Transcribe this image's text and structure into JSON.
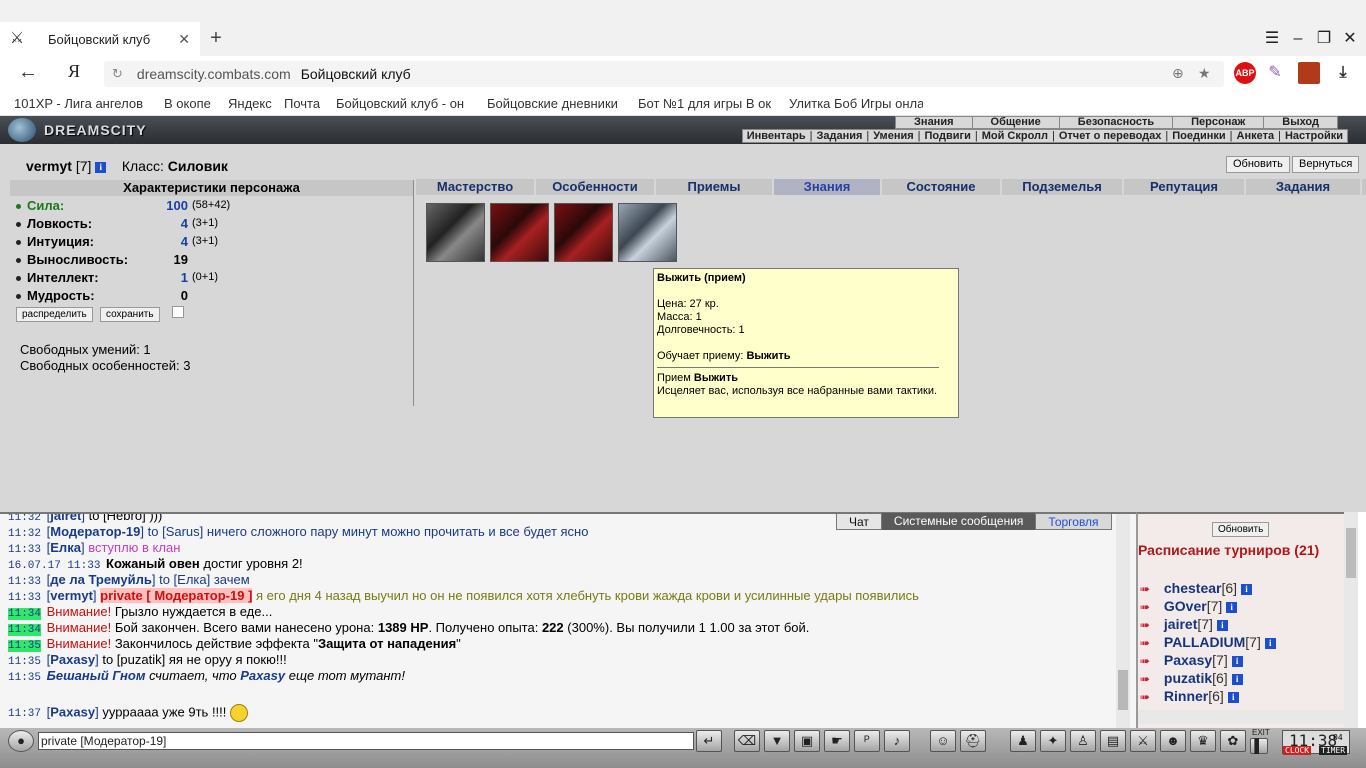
{
  "browser": {
    "tab_title": "Бойцовский клуб",
    "tab_close": "✕",
    "new_tab": "+",
    "url_domain": "dreamscity.combats.com",
    "url_title": "Бойцовский клуб",
    "bookmarks": [
      "101XP - Лига ангелов",
      "В окопе",
      "Яндекс",
      "Почта",
      "Бойцовский клуб - он",
      "Бойцовские дневники",
      "Бот №1 для игры В ок",
      "Улитка Боб Игры онла"
    ],
    "extensions": {
      "abp": "ABP"
    }
  },
  "game": {
    "logo": "DREAMSCITY",
    "main_menu": [
      "Знания",
      "Общение",
      "Безопасность",
      "Персонаж",
      "Выход"
    ],
    "sub_menu": [
      "Инвентарь",
      "Задания",
      "Умения",
      "Подвиги",
      "Мой Скролл",
      "Отчет о переводах",
      "Поединки",
      "Анкета",
      "Настройки"
    ]
  },
  "character": {
    "name": "vermyt",
    "level": "[7]",
    "class_label": "Класс:",
    "class_value": "Силовик",
    "btn_refresh": "Обновить",
    "btn_back": "Вернуться"
  },
  "stats": {
    "header": "Характеристики персонажа",
    "items": [
      {
        "label": "Сила:",
        "value": "100",
        "bonus": "(58+42)"
      },
      {
        "label": "Ловкость:",
        "value": "4",
        "bonus": "(3+1)"
      },
      {
        "label": "Интуиция:",
        "value": "4",
        "bonus": "(3+1)"
      },
      {
        "label": "Выносливость:",
        "value": "19",
        "bonus": ""
      },
      {
        "label": "Интеллект:",
        "value": "1",
        "bonus": "(0+1)"
      },
      {
        "label": "Мудрость:",
        "value": "0",
        "bonus": ""
      }
    ],
    "btn_distribute": "распределить",
    "btn_save": "сохранить",
    "free_skills": "Свободных умений: 1",
    "free_features": "Свободных особенностей: 3"
  },
  "tabs": [
    "Мастерство",
    "Особенности",
    "Приемы",
    "Знания",
    "Состояние",
    "Подземелья",
    "Репутация",
    "Задания"
  ],
  "selected_tab": "Знания",
  "tooltip": {
    "title": "Выжить (прием)",
    "price": "Цена: 27 кр.",
    "mass": "Масса: 1",
    "durability": "Долговечность: 1",
    "teaches_label": "Обучает приему:",
    "teaches_value": "Выжить",
    "skill_label": "Прием",
    "skill_name": "Выжить",
    "skill_desc": "Исцеляет вас, используя все набранные вами тактики."
  },
  "chat": {
    "tabs": [
      "Чат",
      "Системные сообщения",
      "Торговля"
    ],
    "lines": [
      {
        "time": "11:32",
        "nick": "jairet",
        "to": "to [Hebro]",
        "msg": ")))"
      },
      {
        "time": "11:32",
        "nick": "Модератор-19",
        "to": "to [Sarus]",
        "msg": "ничего сложного пару минут можно прочитать и все будет ясно"
      },
      {
        "time": "11:33",
        "nick": "Елка",
        "msg": "вступлю в клан"
      },
      {
        "time": "16.07.17 11:33",
        "bold": "Кожаный овен",
        "msg": "достиг уровня 2!"
      },
      {
        "time": "11:33",
        "nick": "де ла Тремуйль",
        "to": "to [Елка]",
        "msg": "зачем"
      },
      {
        "time": "11:33",
        "nick": "vermyt",
        "priv": "private [ Модератор-19 ]",
        "msg": "я его дня 4 назад выучил но он не появился хотя хлебнуть крови жажда крови и усилинные удары появились"
      },
      {
        "time": "11:34",
        "warn": "Внимание!",
        "msg": "Грызло нуждается в еде..."
      },
      {
        "time": "11:34",
        "warn": "Внимание!",
        "msg_a": "Бой закончен. Всего вами нанесено урона:",
        "dmg": "1389 HP",
        "msg_b": ". Получено опыта:",
        "exp": "222",
        "msg_c": "(300%). Вы получили",
        "reward": "1 1.00 за этот бой."
      },
      {
        "time": "11:35",
        "warn": "Внимание!",
        "msg_a": "Закончилось действие эффекта \"",
        "effect": "Защита от нападения",
        "msg_b": "\""
      },
      {
        "time": "11:35",
        "nick": "Paxasy",
        "to": "to [puzatik]",
        "msg": "яя не оруу я покю!!!"
      },
      {
        "time": "11:35",
        "italic_a": "Бешаный Гном",
        "msg": "считает, что",
        "italic_b": "Paxasy",
        "msg2": "еще тот мутант!"
      },
      {
        "time": "11:37",
        "nick": "Paxasy",
        "msg": "уурраааа уже 9ть !!!!"
      }
    ],
    "input_value": "private [Модератор-19]"
  },
  "tournament": {
    "btn_refresh": "Обновить",
    "title": "Расписание турниров (21)",
    "players": [
      {
        "name": "chestear",
        "level": "[6]"
      },
      {
        "name": "GOver",
        "level": "[7]"
      },
      {
        "name": "jairet",
        "level": "[7]"
      },
      {
        "name": "PALLADIUM",
        "level": "[7]"
      },
      {
        "name": "Paxasy",
        "level": "[7]"
      },
      {
        "name": "puzatik",
        "level": "[6]"
      },
      {
        "name": "Rinner",
        "level": "[6]"
      }
    ]
  },
  "clock": {
    "time": "11:38",
    "seconds": "04",
    "label1": "CLOCK",
    "label2": "TIMER",
    "exit": "EXIT"
  }
}
